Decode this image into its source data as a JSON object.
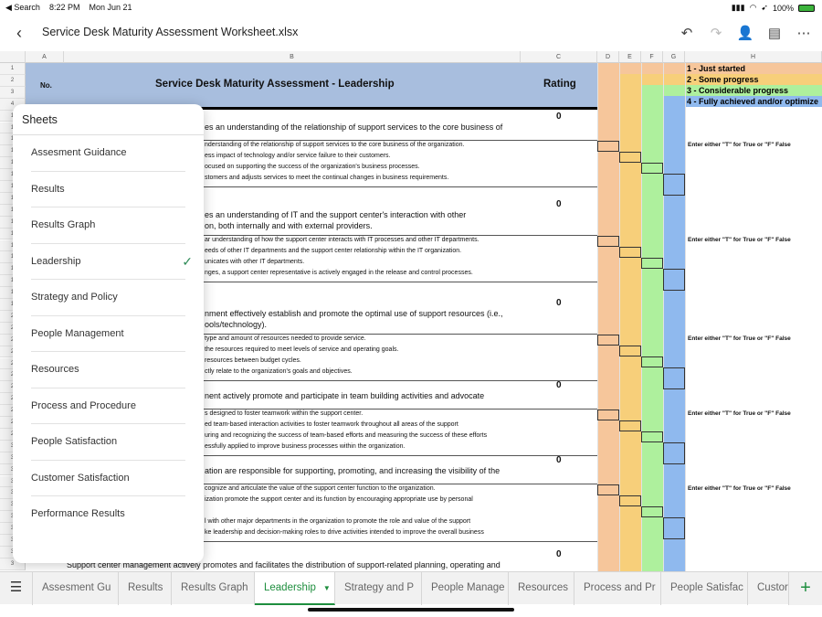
{
  "status_bar": {
    "back_app": "◀ Search",
    "time": "8:22 PM",
    "date": "Mon Jun 21",
    "battery": "100%"
  },
  "title_bar": {
    "title": "Service Desk Maturity Assessment Worksheet.xlsx"
  },
  "columns": [
    "A",
    "B",
    "C",
    "D",
    "E",
    "F",
    "G",
    "H"
  ],
  "header": {
    "no": "No.",
    "title": "Service Desk Maturity Assessment - Leadership",
    "rating": "Rating"
  },
  "legend": [
    "1 - Just started",
    "2 - Some progress",
    "3 - Considerable progress",
    "4 - Fully achieved and/or optimize"
  ],
  "colors": {
    "band_d": "#f6c69b",
    "band_e": "#f7cf7a",
    "band_f": "#aef09d",
    "band_g": "#8fb9ee",
    "header": "#a8bede",
    "accent": "#1e8e3e"
  },
  "row_numbers": [
    "1",
    "2",
    "3",
    "4",
    "1",
    "1",
    "1",
    "1",
    "1",
    "1",
    "1",
    "1",
    "1",
    "1",
    "1",
    "1",
    "1",
    "1",
    "1",
    "1",
    "1",
    "2",
    "2",
    "2",
    "2",
    "2",
    "2",
    "2",
    "2",
    "2",
    "2",
    "2",
    "3",
    "3",
    "3",
    "3",
    "3",
    "3",
    "3",
    "3",
    "3",
    "3",
    "3"
  ],
  "sections": [
    {
      "question": "es an understanding of the relationship of support services to the core business of",
      "question2": "",
      "rating": "0",
      "enter": "Enter either \"T\" for True or \"F\" False",
      "subs": [
        "nderstanding of the relationship of support services to the core business of the organization.",
        "ess impact of technology and/or service failure to their customers.",
        "ocused on supporting the success of the organization's business processes.",
        "stomers and adjusts services to meet the continual changes in business requirements."
      ]
    },
    {
      "question": "es an understanding of IT and the support center's interaction with other",
      "question2": "on, both internally and with external providers.",
      "rating": "0",
      "enter": "Enter either \"T\" for True or \"F\" False",
      "subs": [
        "ar understanding of how the support center interacts with IT processes and other IT departments.",
        "eeds of other IT departments and the support center relationship within the IT organization.",
        "unicates with other IT departments.",
        "nges, a support center representative is actively engaged in the release and control processes."
      ]
    },
    {
      "question": "nment effectively establish and promote the optimal use of support resources (i.e.,",
      "question2": "ools/technology).",
      "rating": "0",
      "enter": "Enter either \"T\" for True or \"F\" False",
      "subs": [
        "type and amount of resources needed to provide service.",
        "the resources required to meet levels of service and operating goals.",
        "resources between budget cycles.",
        "ctly relate to the organization's goals and objectives."
      ]
    },
    {
      "question": "nent actively promote and participate in team building activities and advocate",
      "question2": "",
      "rating": "0",
      "enter": "Enter either \"T\" for True or \"F\" False",
      "subs": [
        "s designed to foster teamwork within the support center.",
        "ed team-based interaction activities to foster teamwork throughout all areas of the support",
        "uring and recognizing the success of team-based efforts and measuring the success of these efforts",
        "essfully applied to improve business processes within the organization."
      ]
    },
    {
      "question": "ation are responsible for supporting, promoting, and increasing the visibility of the",
      "question2": "",
      "rating": "0",
      "enter": "Enter either \"T\" for True or \"F\" False",
      "subs": [
        "cognize and articulate the value of the support center function to the organization.",
        "ization promote the support center and its function by encouraging appropriate use by personal",
        "",
        "l with other major departments in the organization to promote the role and value of the support",
        "ke leadership and decision-making roles to drive activities intended to improve the overall business"
      ]
    },
    {
      "question": "Support center management actively promotes and facilitates the distribution of support-related planning, operating and",
      "question2": "",
      "rating": "0",
      "enter": "",
      "subs": []
    }
  ],
  "sheets_panel": {
    "title": "Sheets",
    "items": [
      "Assesment Guidance",
      "Results",
      "Results Graph",
      "Leadership",
      "Strategy and Policy",
      "People Management",
      "Resources",
      "Process and Procedure",
      "People Satisfaction",
      "Customer Satisfaction",
      "Performance Results"
    ],
    "selected": "Leadership"
  },
  "tabs": [
    "Assesment Gu",
    "Results",
    "Results Graph",
    "Leadership",
    "Strategy and P",
    "People Manage",
    "Resources",
    "Process and Pr",
    "People Satisfac",
    "Custor"
  ],
  "active_tab": "Leadership"
}
